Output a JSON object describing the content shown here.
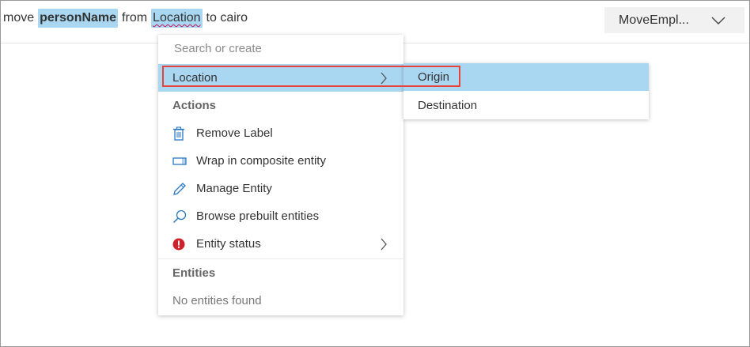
{
  "utterance": {
    "tokens": [
      {
        "text": "move",
        "labeled": false
      },
      {
        "text": "personName",
        "labeled": true,
        "bold": true
      },
      {
        "text": "from",
        "labeled": false
      },
      {
        "text": "Location",
        "labeled": true,
        "bold": false
      },
      {
        "text": "to cairo",
        "labeled": false
      }
    ]
  },
  "intent_select": {
    "value": "MoveEmpl...",
    "icon": "chevron-down-icon"
  },
  "menu": {
    "search_placeholder": "Search or create",
    "selected_item": {
      "label": "Location",
      "icon": "chevron-right-icon"
    },
    "actions_header": "Actions",
    "actions": [
      {
        "label": "Remove Label",
        "icon": "trash-icon"
      },
      {
        "label": "Wrap in composite entity",
        "icon": "wrap-icon"
      },
      {
        "label": "Manage Entity",
        "icon": "pencil-icon"
      },
      {
        "label": "Browse prebuilt entities",
        "icon": "search-icon"
      },
      {
        "label": "Entity status",
        "icon": "error-icon"
      }
    ],
    "entities_header": "Entities",
    "entities_empty": "No entities found"
  },
  "submenu": {
    "items": [
      {
        "label": "Origin",
        "selected": true
      },
      {
        "label": "Destination",
        "selected": false
      }
    ]
  },
  "colors": {
    "label_highlight": "#a9d6f0",
    "annotation_border": "#e8433a",
    "icon_blue": "#2b79c2",
    "error_red": "#d0212b"
  }
}
